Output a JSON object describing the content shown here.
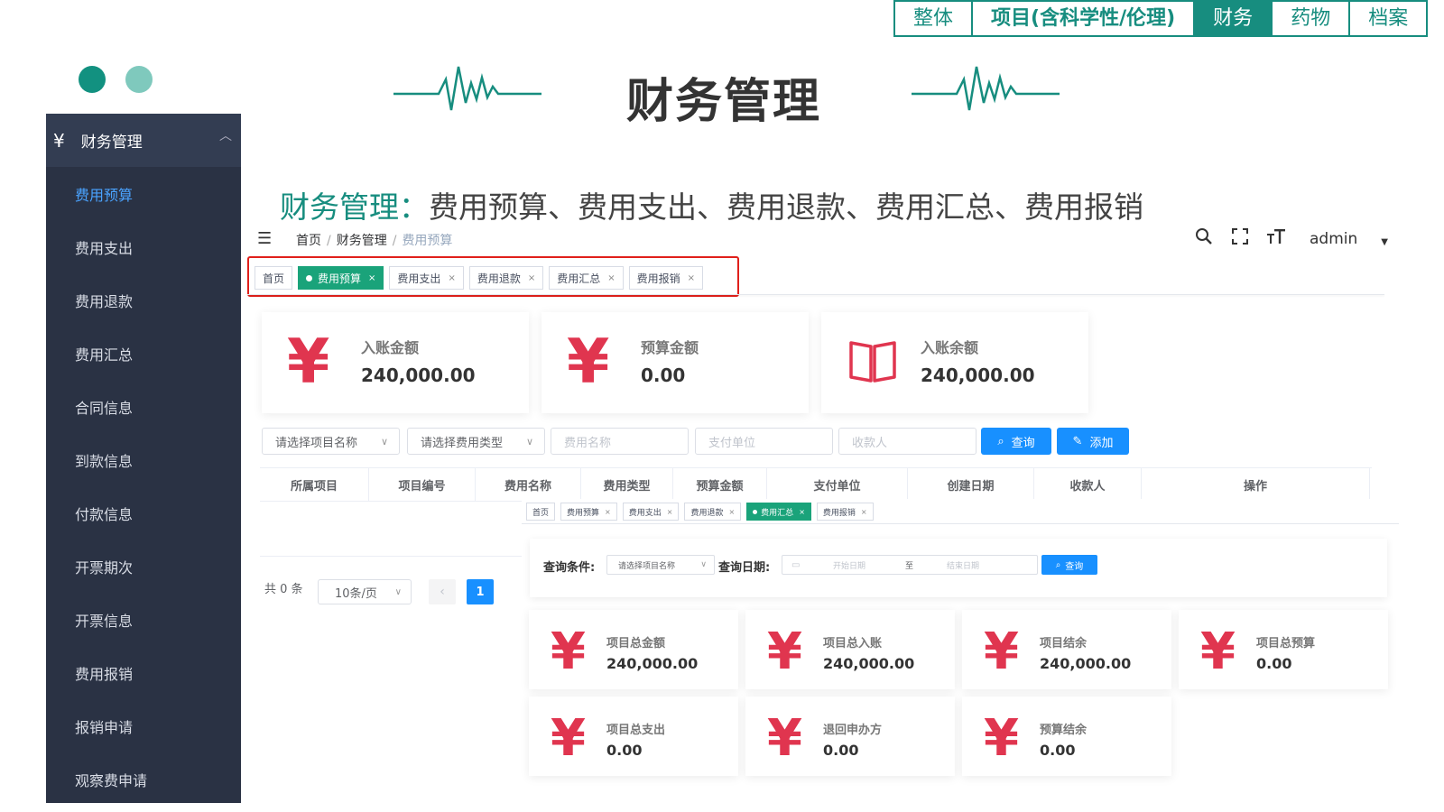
{
  "topnav": [
    "整体",
    "项目(含科学性/伦理)",
    "财务",
    "药物",
    "档案"
  ],
  "title": "财务管理",
  "subtitle": {
    "label": "财务管理：",
    "text": "费用预算、费用支出、费用退款、费用汇总、费用报销"
  },
  "colors": {
    "accent": "#178d7f",
    "sidebar": "#2a3244",
    "primary": "#1890ff",
    "tag_active": "#1aa37a",
    "icon_red": "#e0354f"
  },
  "sidebar": {
    "header": "财务管理",
    "items": [
      "费用预算",
      "费用支出",
      "费用退款",
      "费用汇总",
      "合同信息",
      "到款信息",
      "付款信息",
      "开票期次",
      "开票信息",
      "费用报销",
      "报销申请",
      "观察费申请"
    ]
  },
  "breadcrumb": [
    "首页",
    "财务管理",
    "费用预算"
  ],
  "header": {
    "user": "admin"
  },
  "tags": [
    {
      "label": "首页"
    },
    {
      "label": "费用预算",
      "active": true
    },
    {
      "label": "费用支出"
    },
    {
      "label": "费用退款"
    },
    {
      "label": "费用汇总"
    },
    {
      "label": "费用报销"
    }
  ],
  "stats": [
    {
      "label": "入账金额",
      "value": "240,000.00",
      "icon": "yen-icon"
    },
    {
      "label": "预算金额",
      "value": "0.00",
      "icon": "yen-icon"
    },
    {
      "label": "入账余额",
      "value": "240,000.00",
      "icon": "book-icon"
    }
  ],
  "search": {
    "project_placeholder": "请选择项目名称",
    "type_placeholder": "请选择费用类型",
    "name_placeholder": "费用名称",
    "unit_placeholder": "支付单位",
    "payee_placeholder": "收款人",
    "query_label": "查询",
    "add_label": "添加"
  },
  "table": {
    "columns": [
      "所属项目",
      "项目编号",
      "费用名称",
      "费用类型",
      "预算金额",
      "支付单位",
      "创建日期",
      "收款人",
      "操作"
    ]
  },
  "pagination": {
    "total": "共 0 条",
    "page_size": "10条/页",
    "current": "1"
  },
  "overlay": {
    "tags": [
      {
        "label": "首页"
      },
      {
        "label": "费用预算"
      },
      {
        "label": "费用支出"
      },
      {
        "label": "费用退款"
      },
      {
        "label": "费用汇总",
        "active": true
      },
      {
        "label": "费用报销"
      }
    ],
    "query": {
      "label": "查询条件:",
      "project_placeholder": "请选择项目名称",
      "date_label": "查询日期:",
      "start": "开始日期",
      "to": "至",
      "end": "结束日期",
      "button": "查询"
    },
    "stats": [
      {
        "label": "项目总金额",
        "value": "240,000.00"
      },
      {
        "label": "项目总入账",
        "value": "240,000.00"
      },
      {
        "label": "项目结余",
        "value": "240,000.00"
      },
      {
        "label": "项目总预算",
        "value": "0.00"
      },
      {
        "label": "项目总支出",
        "value": "0.00"
      },
      {
        "label": "退回申办方",
        "value": "0.00"
      },
      {
        "label": "预算结余",
        "value": "0.00"
      }
    ]
  }
}
